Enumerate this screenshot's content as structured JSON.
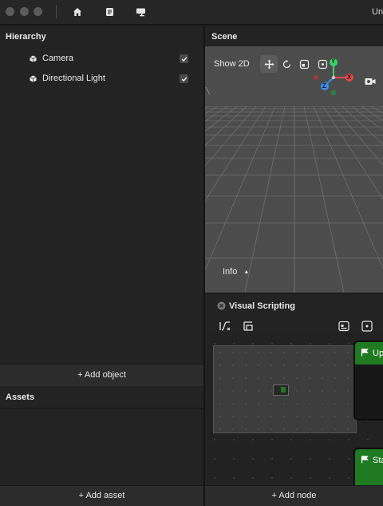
{
  "titlebar": {
    "title": "Unt",
    "icons": [
      "home-icon",
      "document-icon",
      "monitor-icon"
    ]
  },
  "hierarchy": {
    "title": "Hierarchy",
    "items": [
      {
        "label": "Camera",
        "checked": true
      },
      {
        "label": "Directional Light",
        "checked": true
      }
    ],
    "add_label": "+ Add object"
  },
  "assets": {
    "title": "Assets",
    "add_label": "+ Add asset"
  },
  "scene": {
    "title": "Scene",
    "show2d_label": "Show 2D",
    "tools": [
      "move-tool-icon",
      "rotate-tool-icon",
      "scale-tool-icon",
      "rect-tool-icon"
    ],
    "gizmo": {
      "y": "Y",
      "x": "X",
      "z": "Z"
    },
    "info_label": "Info"
  },
  "visual_scripting": {
    "title": "Visual Scripting",
    "nodes": [
      {
        "label": "Upd"
      },
      {
        "label": "Sta"
      }
    ],
    "add_label": "+ Add node"
  },
  "colors": {
    "node_green": "#1f7a22",
    "axis_y": "#3dd16a",
    "axis_x": "#e04848",
    "axis_z": "#3a8ee6"
  }
}
